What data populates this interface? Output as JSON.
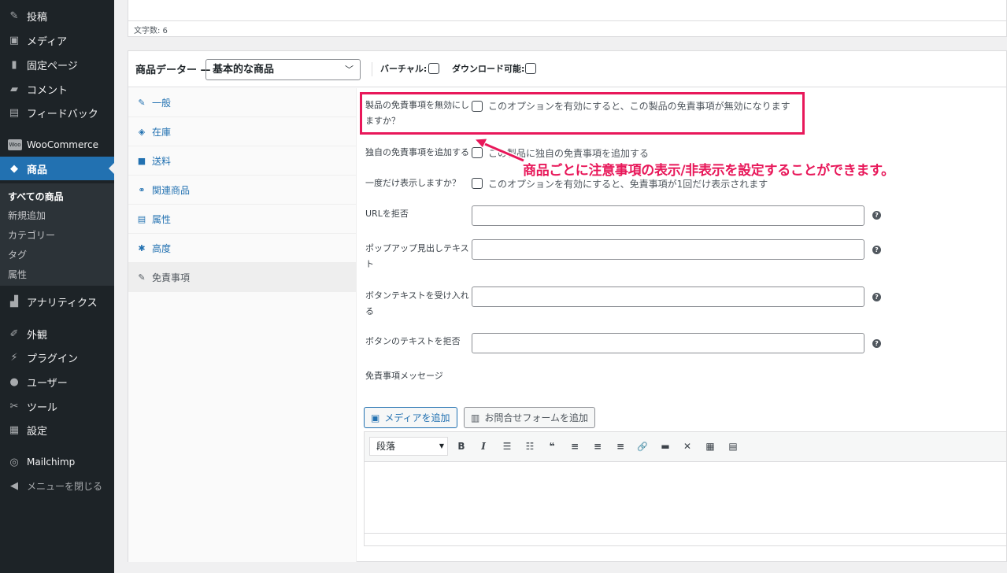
{
  "sidebar": {
    "items": [
      {
        "label": "投稿",
        "icon": "pin-icon"
      },
      {
        "label": "メディア",
        "icon": "media-icon"
      },
      {
        "label": "固定ページ",
        "icon": "page-icon"
      },
      {
        "label": "コメント",
        "icon": "comment-icon"
      },
      {
        "label": "フィードバック",
        "icon": "feedback-icon"
      },
      {
        "label": "WooCommerce",
        "icon": "woo-icon"
      },
      {
        "label": "商品",
        "icon": "product-icon"
      },
      {
        "label": "アナリティクス",
        "icon": "analytics-icon"
      },
      {
        "label": "外観",
        "icon": "appearance-icon"
      },
      {
        "label": "プラグイン",
        "icon": "plugin-icon"
      },
      {
        "label": "ユーザー",
        "icon": "user-icon"
      },
      {
        "label": "ツール",
        "icon": "tool-icon"
      },
      {
        "label": "設定",
        "icon": "settings-icon"
      },
      {
        "label": "Mailchimp",
        "icon": "mailchimp-icon"
      },
      {
        "label": "メニューを閉じる",
        "icon": "collapse-icon"
      }
    ],
    "woo_badge": "Woo",
    "submenu": [
      "すべての商品",
      "新規追加",
      "カテゴリー",
      "タグ",
      "属性"
    ]
  },
  "editor_top": {
    "char_count": "文字数: 6"
  },
  "product_data": {
    "label": "商品データー —",
    "type_value": "基本的な商品",
    "virtual_label": "バーチャル:",
    "downloadable_label": "ダウンロード可能:"
  },
  "tabs": [
    {
      "label": "一般",
      "icon": "wrench-icon"
    },
    {
      "label": "在庫",
      "icon": "tag-icon"
    },
    {
      "label": "送料",
      "icon": "truck-icon"
    },
    {
      "label": "関連商品",
      "icon": "link-icon"
    },
    {
      "label": "属性",
      "icon": "table-icon"
    },
    {
      "label": "高度",
      "icon": "gear-icon"
    },
    {
      "label": "免責事項",
      "icon": "wrench-icon"
    }
  ],
  "fields": {
    "disable_label_1": "製品の免責事項を無効にし",
    "disable_label_2": "ますか？",
    "disable_desc": "このオプションを有効にすると、この製品の免責事項が無効になります",
    "custom_label": "独自の免責事項を追加する",
    "custom_desc": "この製品に独自の免責事項を追加する",
    "once_label": "一度だけ表示しますか？",
    "once_desc": "このオプションを有効にすると、免責事項が1回だけ表示されます",
    "reject_url_label": "URLを拒否",
    "popup_heading_label_1": "ポップアップ見出しテキス",
    "popup_heading_label_2": "ト",
    "accept_text_label_1": "ボタンテキストを受け入れ",
    "accept_text_label_2": "る",
    "reject_text_label": "ボタンのテキストを拒否",
    "message_label": "免責事項メッセージ",
    "help_glyph": "?"
  },
  "editor": {
    "add_media": "メディアを追加",
    "add_form": "お問合せフォームを追加",
    "format_select": "段落",
    "toolbar": [
      "B",
      "I",
      "☰",
      "☷",
      "❝",
      "≡",
      "≡",
      "≡",
      "🔗",
      "▬",
      "✕",
      "▦",
      "▤"
    ]
  },
  "annotation": {
    "text": "商品ごとに注意事項の表示/非表示を設定することができます。",
    "color": "#e8185a"
  }
}
